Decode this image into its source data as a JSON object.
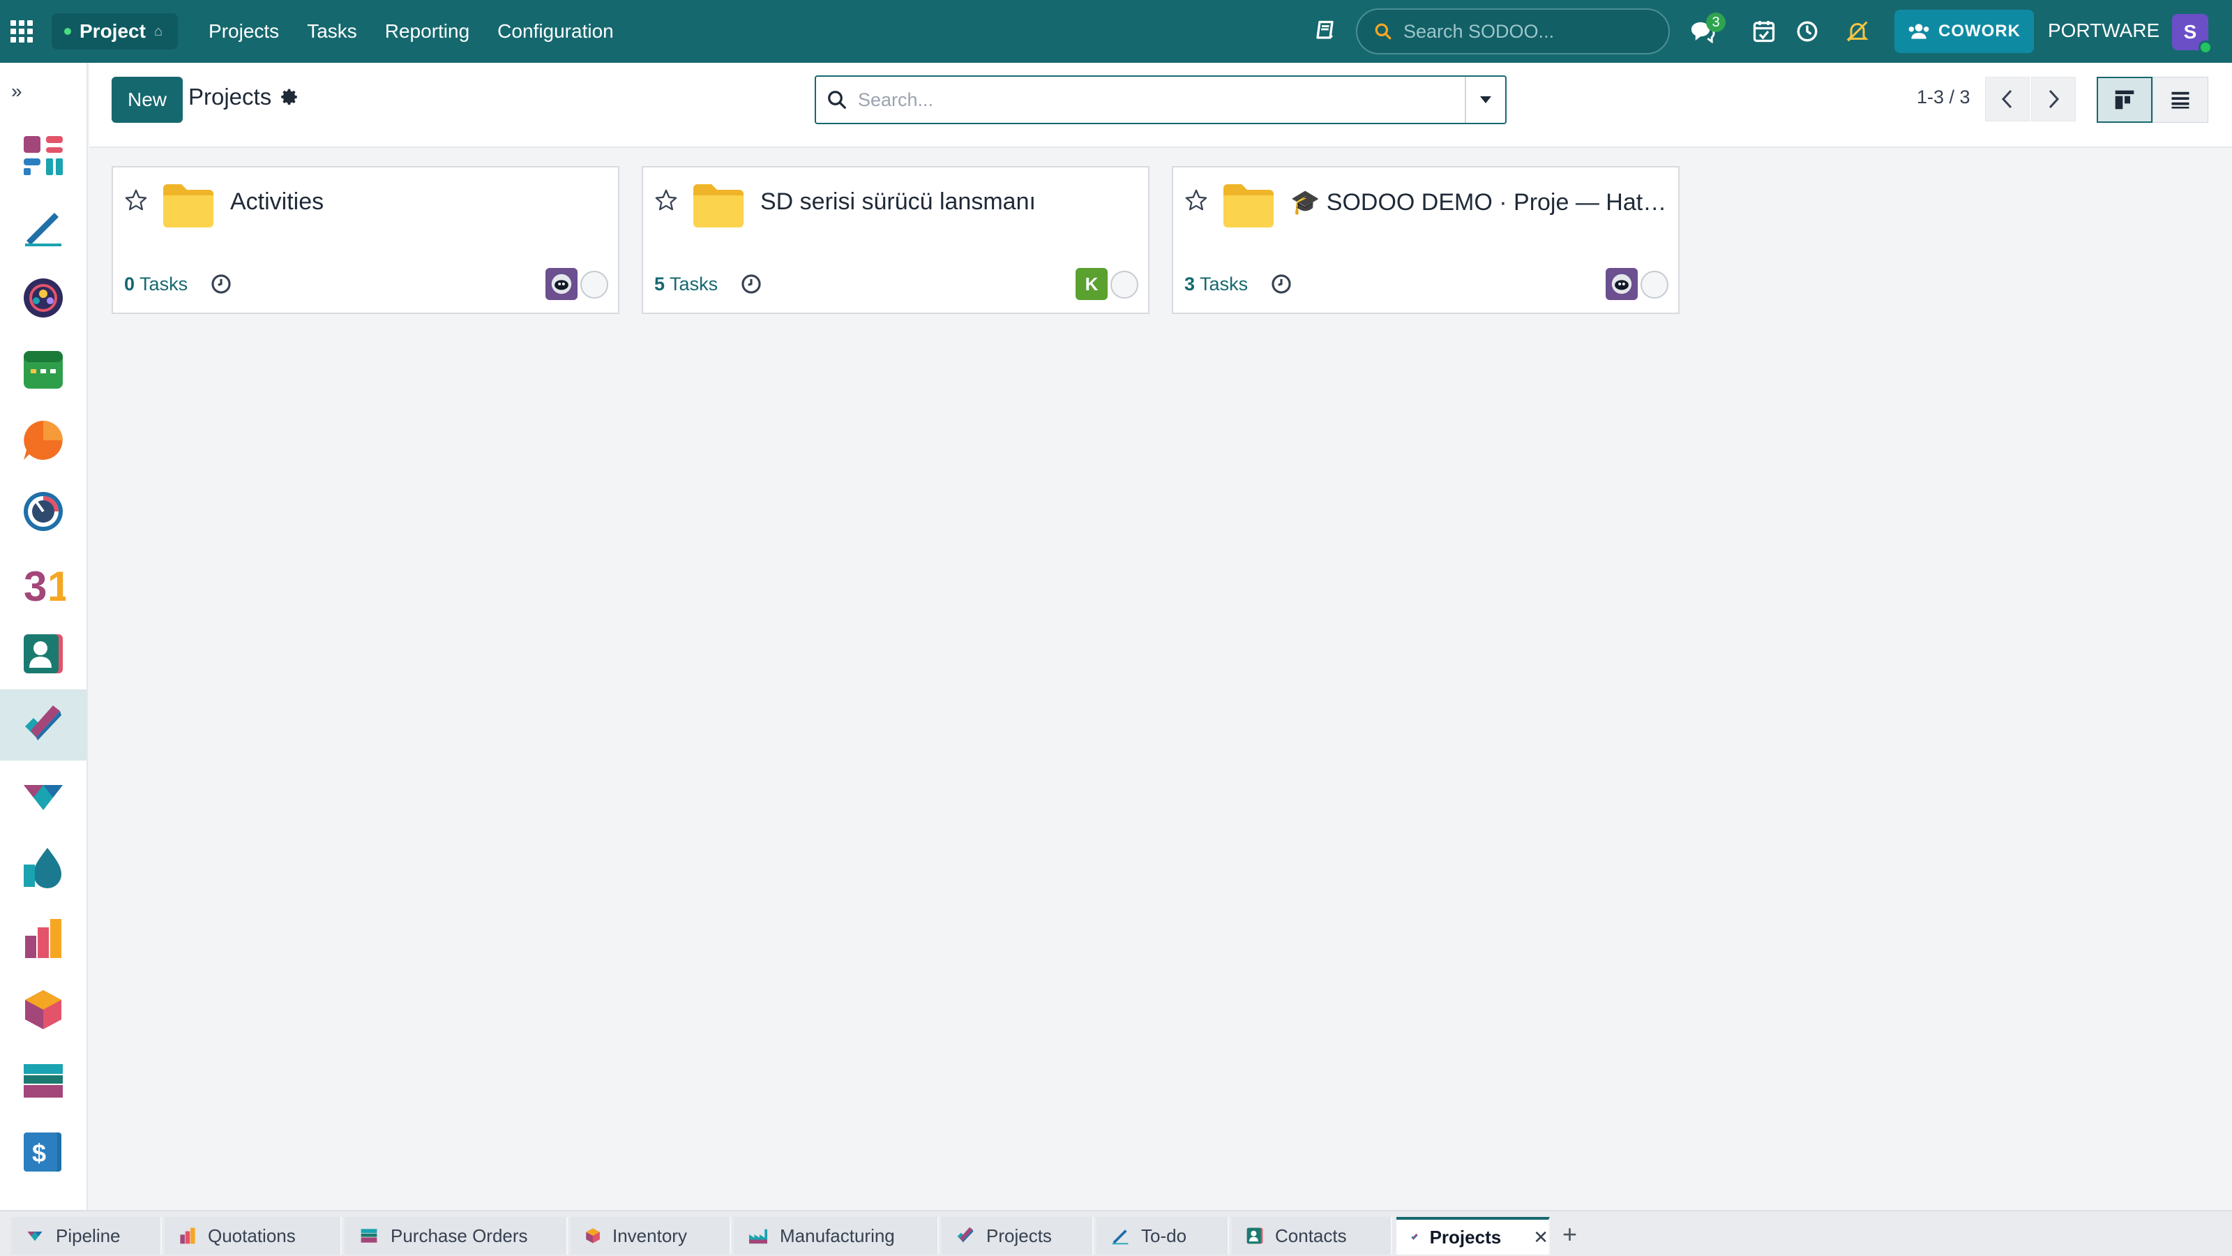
{
  "topbar": {
    "app_name": "Project",
    "menu": [
      "Projects",
      "Tasks",
      "Reporting",
      "Configuration"
    ],
    "search_placeholder": "Search SODOO...",
    "messages_count": "3",
    "cowork_label": "COWORK",
    "company": "PORTWARE",
    "user_initial": "S"
  },
  "control": {
    "new_label": "New",
    "breadcrumb": "Projects",
    "search_placeholder": "Search...",
    "pager": "1-3 / 3"
  },
  "cards": [
    {
      "title": "Activities",
      "task_count": "0",
      "task_label": "Tasks",
      "owner_color": "#6b4f8f",
      "owner_initial": ""
    },
    {
      "title": "SD serisi sürücü lansmanı",
      "task_count": "5",
      "task_label": "Tasks",
      "owner_color": "#5aa12f",
      "owner_initial": "K"
    },
    {
      "title": "🎓 SODOO DEMO · Proje — Hat Sonu Kalite Kontrol",
      "task_count": "3",
      "task_label": "Tasks",
      "owner_color": "#6b4f8f",
      "owner_initial": ""
    }
  ],
  "bottom_tabs": [
    "Pipeline",
    "Quotations",
    "Purchase Orders",
    "Inventory",
    "Manufacturing",
    "Projects",
    "To-do",
    "Contacts",
    "Projects"
  ],
  "colors": {
    "primary": "#16686f",
    "cowork": "#0f8aa3"
  }
}
